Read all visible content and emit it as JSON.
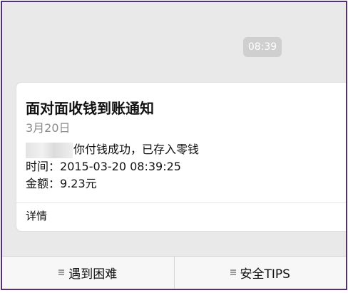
{
  "chat": {
    "timestamp": "08:39"
  },
  "notification_card": {
    "title": "面对面收钱到账通知",
    "date": "3月20日",
    "message": "你付钱成功，已存入零钱",
    "time_label": "时间：",
    "time_value": "2015-03-20 08:39:25",
    "amount_label": "金额：",
    "amount_value": "9.23元",
    "details_link": "详情"
  },
  "bottom_bar": {
    "left_label": "遇到困难",
    "right_label": "安全TIPS"
  },
  "colors": {
    "background": "#e9e9e9",
    "card": "#ffffff",
    "timestamp_bubble": "#cfcfcf",
    "date_text": "#8b8b8b",
    "border": "#55307a"
  },
  "icons": {
    "bottom_menu": "menu-icon"
  }
}
